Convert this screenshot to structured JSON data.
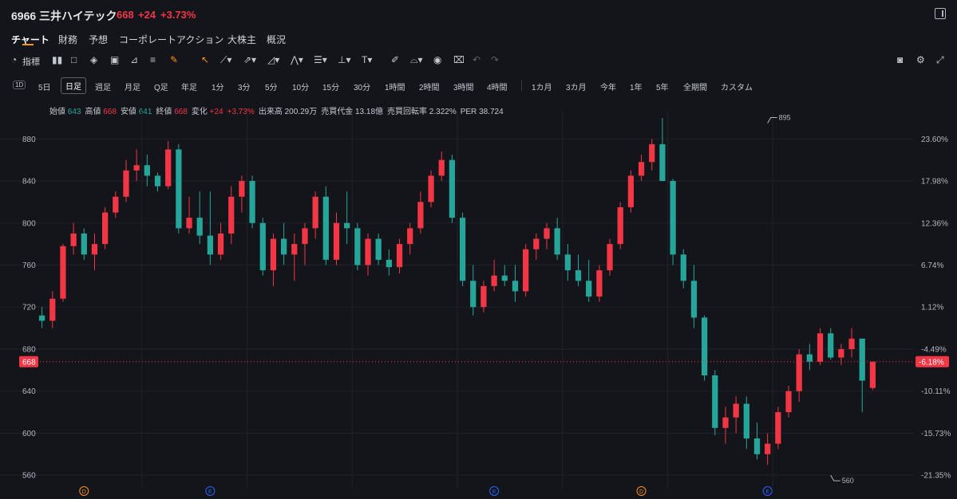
{
  "header": {
    "ticker": "6966 三井ハイテック",
    "last": "668",
    "change": "+24",
    "change_pct": "+3.73%",
    "up_color": "#f23645",
    "down_color": "#26a69a"
  },
  "tabs": [
    "チャート",
    "財務",
    "予想",
    "コーポレートアクション",
    "大株主",
    "概況"
  ],
  "active_tab": "チャート",
  "toolbar": {
    "indicator_label": "指標"
  },
  "ranges": [
    "5日",
    "日足",
    "週足",
    "月足",
    "Q足",
    "年足",
    "1分",
    "3分",
    "5分",
    "10分",
    "15分",
    "30分",
    "1時間",
    "2時間",
    "3時間",
    "4時間",
    "1カ月",
    "3カ月",
    "今年",
    "1年",
    "5年",
    "全期間",
    "カスタム"
  ],
  "active_range": "日足",
  "range_icon": "1D",
  "legend": [
    {
      "label": "始値",
      "value": "643",
      "color": "green"
    },
    {
      "label": "高値",
      "value": "668",
      "color": "red"
    },
    {
      "label": "安値",
      "value": "641",
      "color": "green"
    },
    {
      "label": "終値",
      "value": "668",
      "color": "red"
    },
    {
      "label": "変化",
      "value": "+24",
      "color": "red"
    },
    {
      "label": "",
      "value": "+3.73%",
      "color": "red"
    },
    {
      "label": "出来高",
      "value": "200.29万",
      "color": "none"
    },
    {
      "label": "売買代金",
      "value": "13.18億",
      "color": "none"
    },
    {
      "label": "売買回転率",
      "value": "2.322%",
      "color": "none"
    },
    {
      "label": "PER",
      "value": "38.724",
      "color": "none"
    }
  ],
  "chart_data": {
    "type": "candlestick",
    "ylim": [
      548,
      906
    ],
    "y_ticks": [
      560,
      600,
      640,
      680,
      720,
      760,
      800,
      840,
      880
    ],
    "pct_ticks": [
      "23.60%",
      "17.98%",
      "12.36%",
      "6.74%",
      "1.12%",
      "-4.49%",
      "-6.18%",
      "-10.11%",
      "-15.73%",
      "-21.35%"
    ],
    "pct_values": [
      880,
      840,
      800,
      760,
      720,
      680,
      668,
      640,
      600,
      560
    ],
    "current_price": 668,
    "current_price_label": "668",
    "current_pct_label": "-6.18%",
    "high_marker": {
      "index": 69,
      "value": 895,
      "label": "895"
    },
    "low_marker": {
      "index": 75,
      "value": 560,
      "label": "560"
    },
    "events": [
      {
        "index": 4,
        "label": "D",
        "color": "#f7931a"
      },
      {
        "index": 16,
        "label": "E",
        "color": "#2962ff"
      },
      {
        "index": 43,
        "label": "E",
        "color": "#2962ff"
      },
      {
        "index": 57,
        "label": "D",
        "color": "#f7931a"
      },
      {
        "index": 69,
        "label": "E",
        "color": "#2962ff"
      }
    ],
    "ohlc": [
      [
        712,
        720,
        700,
        707
      ],
      [
        707,
        735,
        700,
        728
      ],
      [
        728,
        780,
        725,
        778
      ],
      [
        778,
        800,
        770,
        790
      ],
      [
        790,
        795,
        765,
        770
      ],
      [
        770,
        790,
        755,
        780
      ],
      [
        780,
        815,
        775,
        810
      ],
      [
        810,
        830,
        805,
        825
      ],
      [
        825,
        860,
        820,
        850
      ],
      [
        850,
        870,
        840,
        855
      ],
      [
        855,
        865,
        835,
        845
      ],
      [
        845,
        848,
        830,
        835
      ],
      [
        835,
        878,
        832,
        870
      ],
      [
        870,
        875,
        790,
        795
      ],
      [
        795,
        825,
        790,
        805
      ],
      [
        805,
        830,
        780,
        788
      ],
      [
        788,
        830,
        760,
        770
      ],
      [
        770,
        800,
        765,
        790
      ],
      [
        790,
        835,
        780,
        825
      ],
      [
        825,
        845,
        810,
        840
      ],
      [
        840,
        845,
        795,
        800
      ],
      [
        800,
        805,
        750,
        755
      ],
      [
        755,
        790,
        740,
        785
      ],
      [
        785,
        800,
        760,
        770
      ],
      [
        770,
        790,
        745,
        780
      ],
      [
        780,
        800,
        760,
        795
      ],
      [
        795,
        830,
        785,
        825
      ],
      [
        825,
        835,
        760,
        765
      ],
      [
        765,
        810,
        760,
        800
      ],
      [
        800,
        830,
        780,
        795
      ],
      [
        795,
        800,
        755,
        760
      ],
      [
        760,
        790,
        750,
        785
      ],
      [
        785,
        790,
        760,
        765
      ],
      [
        765,
        775,
        750,
        758
      ],
      [
        758,
        785,
        752,
        780
      ],
      [
        780,
        800,
        770,
        795
      ],
      [
        795,
        830,
        790,
        820
      ],
      [
        820,
        850,
        815,
        845
      ],
      [
        845,
        868,
        840,
        860
      ],
      [
        860,
        865,
        800,
        805
      ],
      [
        805,
        810,
        740,
        745
      ],
      [
        745,
        760,
        712,
        720
      ],
      [
        720,
        745,
        715,
        740
      ],
      [
        740,
        765,
        735,
        750
      ],
      [
        750,
        760,
        740,
        745
      ],
      [
        745,
        760,
        725,
        735
      ],
      [
        735,
        780,
        730,
        775
      ],
      [
        775,
        790,
        765,
        785
      ],
      [
        785,
        800,
        775,
        795
      ],
      [
        795,
        805,
        765,
        770
      ],
      [
        770,
        780,
        745,
        755
      ],
      [
        755,
        770,
        740,
        745
      ],
      [
        745,
        765,
        725,
        730
      ],
      [
        730,
        760,
        725,
        755
      ],
      [
        755,
        785,
        750,
        780
      ],
      [
        780,
        820,
        775,
        815
      ],
      [
        815,
        850,
        810,
        845
      ],
      [
        845,
        865,
        840,
        858
      ],
      [
        858,
        880,
        850,
        875
      ],
      [
        875,
        900,
        860,
        840
      ],
      [
        840,
        842,
        760,
        770
      ],
      [
        770,
        775,
        738,
        745
      ],
      [
        745,
        760,
        700,
        710
      ],
      [
        710,
        712,
        650,
        655
      ],
      [
        655,
        660,
        598,
        605
      ],
      [
        605,
        625,
        590,
        615
      ],
      [
        615,
        635,
        600,
        628
      ],
      [
        628,
        635,
        585,
        595
      ],
      [
        595,
        610,
        575,
        580
      ],
      [
        580,
        600,
        570,
        590
      ],
      [
        590,
        625,
        585,
        620
      ],
      [
        620,
        645,
        615,
        640
      ],
      [
        640,
        680,
        630,
        675
      ],
      [
        675,
        685,
        660,
        668
      ],
      [
        668,
        700,
        665,
        695
      ],
      [
        695,
        700,
        670,
        672
      ],
      [
        672,
        685,
        665,
        680
      ],
      [
        680,
        700,
        672,
        690
      ],
      [
        690,
        690,
        620,
        650
      ],
      [
        643,
        668,
        641,
        668
      ]
    ]
  }
}
